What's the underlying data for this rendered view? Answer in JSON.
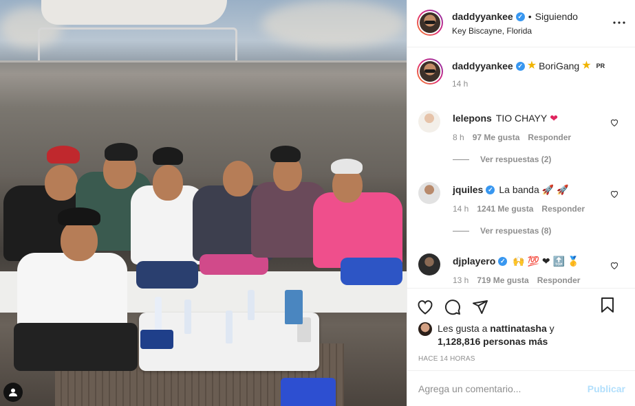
{
  "post": {
    "author": "daddyyankee",
    "follow_dot": "•",
    "follow_status": "Siguiendo",
    "location": "Key Biscayne, Florida",
    "more_icon": "more-horizontal-icon"
  },
  "caption": {
    "username": "daddyyankee",
    "text": "BoriGang",
    "flag": "PR",
    "time": "14 h"
  },
  "comments": [
    {
      "username": "lelepons",
      "text": "TIO CHAYY",
      "emoji": "❤",
      "time": "8 h",
      "likes": "97 Me gusta",
      "reply": "Responder",
      "replies": "Ver respuestas (2)",
      "verified": false
    },
    {
      "username": "jquiles",
      "text": "La banda",
      "emoji": "🚀 🚀",
      "time": "14 h",
      "likes": "1241 Me gusta",
      "reply": "Responder",
      "replies": "Ver respuestas (8)",
      "verified": true
    },
    {
      "username": "djplayero",
      "text": "",
      "emoji": "🙌 💯 ❤ 🔝 🥇",
      "time": "13 h",
      "likes": "719 Me gusta",
      "reply": "Responder",
      "replies": "",
      "verified": true
    }
  ],
  "likes": {
    "prefix": "Les gusta a",
    "user": "nattinatasha",
    "connector": "y",
    "count": "1,128,816 personas más"
  },
  "timestamp": "HACE 14 HORAS",
  "add_comment": {
    "placeholder": "Agrega un comentario...",
    "publish": "Publicar"
  },
  "colors": {
    "verified": "#3897f0",
    "publish_disabled": "#b2dffc",
    "muted": "#8e8e8e",
    "text": "#262626"
  }
}
